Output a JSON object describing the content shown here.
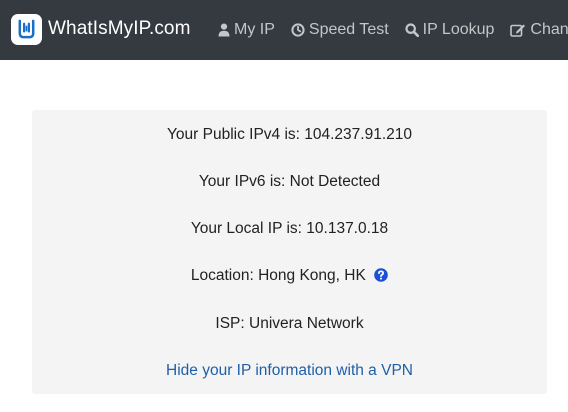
{
  "brand": {
    "name": "WhatIsMyIP.com",
    "logo_icon": "wimi-logo-icon"
  },
  "nav": {
    "items": [
      {
        "label": "My IP",
        "icon": "user-icon"
      },
      {
        "label": "Speed Test",
        "icon": "speedometer-icon"
      },
      {
        "label": "IP Lookup",
        "icon": "search-icon"
      },
      {
        "label": "Chang",
        "icon": "edit-icon"
      }
    ]
  },
  "info": {
    "public_ipv4": "Your Public IPv4 is: 104.237.91.210",
    "ipv6": "Your IPv6 is: Not Detected",
    "local_ip": "Your Local IP is: 10.137.0.18",
    "location": "Location: Hong Kong, HK",
    "isp": "ISP: Univera Network",
    "vpn_link": "Hide your IP information with a VPN"
  },
  "colors": {
    "navbar_bg": "#343a40",
    "card_bg": "#f4f4f4",
    "link": "#1f5fa8",
    "help_icon": "#1b4fd6"
  }
}
